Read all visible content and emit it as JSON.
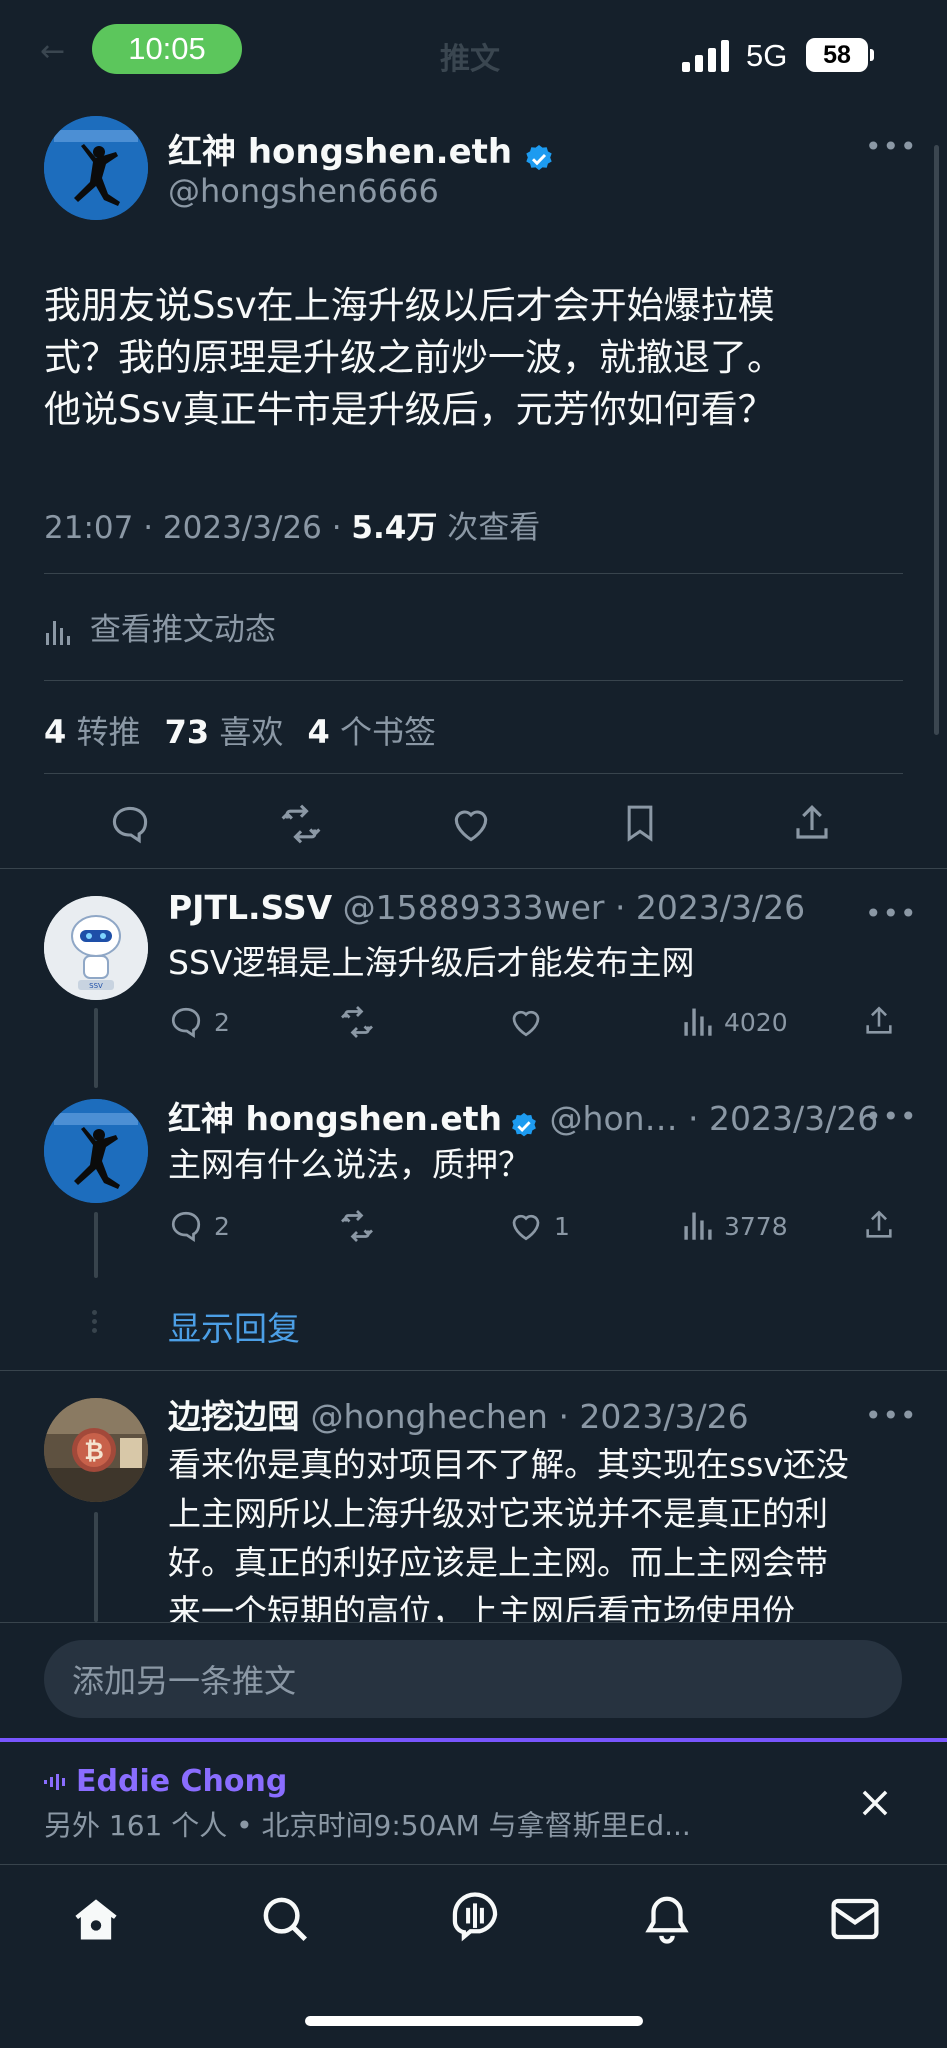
{
  "status_bar": {
    "time": "10:05",
    "network": "5G",
    "battery": "58"
  },
  "header": {
    "back_glyph": "←",
    "title": "推文"
  },
  "tweet": {
    "author_name": "红神 hongshen.eth",
    "handle": "@hongshen6666",
    "text_lines": [
      "我朋友说Ssv在上海升级以后才会开始爆拉模",
      "式？我的原理是升级之前炒一波，就撤退了。",
      "他说Ssv真正牛市是升级后，元芳你如何看？"
    ],
    "time": "21:07 · 2023/3/26 · ",
    "views_count": "5.4万",
    "views_label": " 次查看",
    "analytics_label": "查看推文动态",
    "retweets_count": "4",
    "retweets_label": " 转推",
    "likes_count": "73",
    "likes_label": " 喜欢",
    "bookmarks_count": "4",
    "bookmarks_label": " 个书签"
  },
  "replies": [
    {
      "name": "PJTL.SSV",
      "handle_date": " @15889333wer · 2023/3/26",
      "text": "SSV逻辑是上海升级后才能发布主网",
      "reply_count": "2",
      "like_count": "",
      "views": "4020"
    },
    {
      "name": "红神 hongshen.eth",
      "handle_date": " @hon… · 2023/3/26",
      "text": "主网有什么说法，质押？",
      "reply_count": "2",
      "like_count": "1",
      "views": "3778"
    },
    {
      "name": "边挖边囤",
      "handle_date": " @honghechen · 2023/3/26",
      "text_lines": [
        "看来你是真的对项目不了解。其实现在ssv还没",
        "上主网所以上海升级对它来说并不是真正的利",
        "好。真正的利好应该是上主网。而上主网会带",
        "来一个短期的高位，上主网后看市场使用份"
      ]
    }
  ],
  "show_replies": "显示回复",
  "compose": {
    "placeholder": "添加另一条推文"
  },
  "space": {
    "host": "Eddie Chong",
    "info": "另外  161 个人 • 北京时间9:50AM 与拿督斯里Ed..."
  },
  "colors": {
    "background": "#15202b",
    "accent": "#1d9bf0",
    "link": "#4c9fe6",
    "space_purple": "#7856ff",
    "muted": "#8b98a5"
  },
  "icons": {
    "tabbar": [
      "home-icon",
      "search-icon",
      "spaces-icon",
      "bell-icon",
      "mail-icon"
    ]
  }
}
